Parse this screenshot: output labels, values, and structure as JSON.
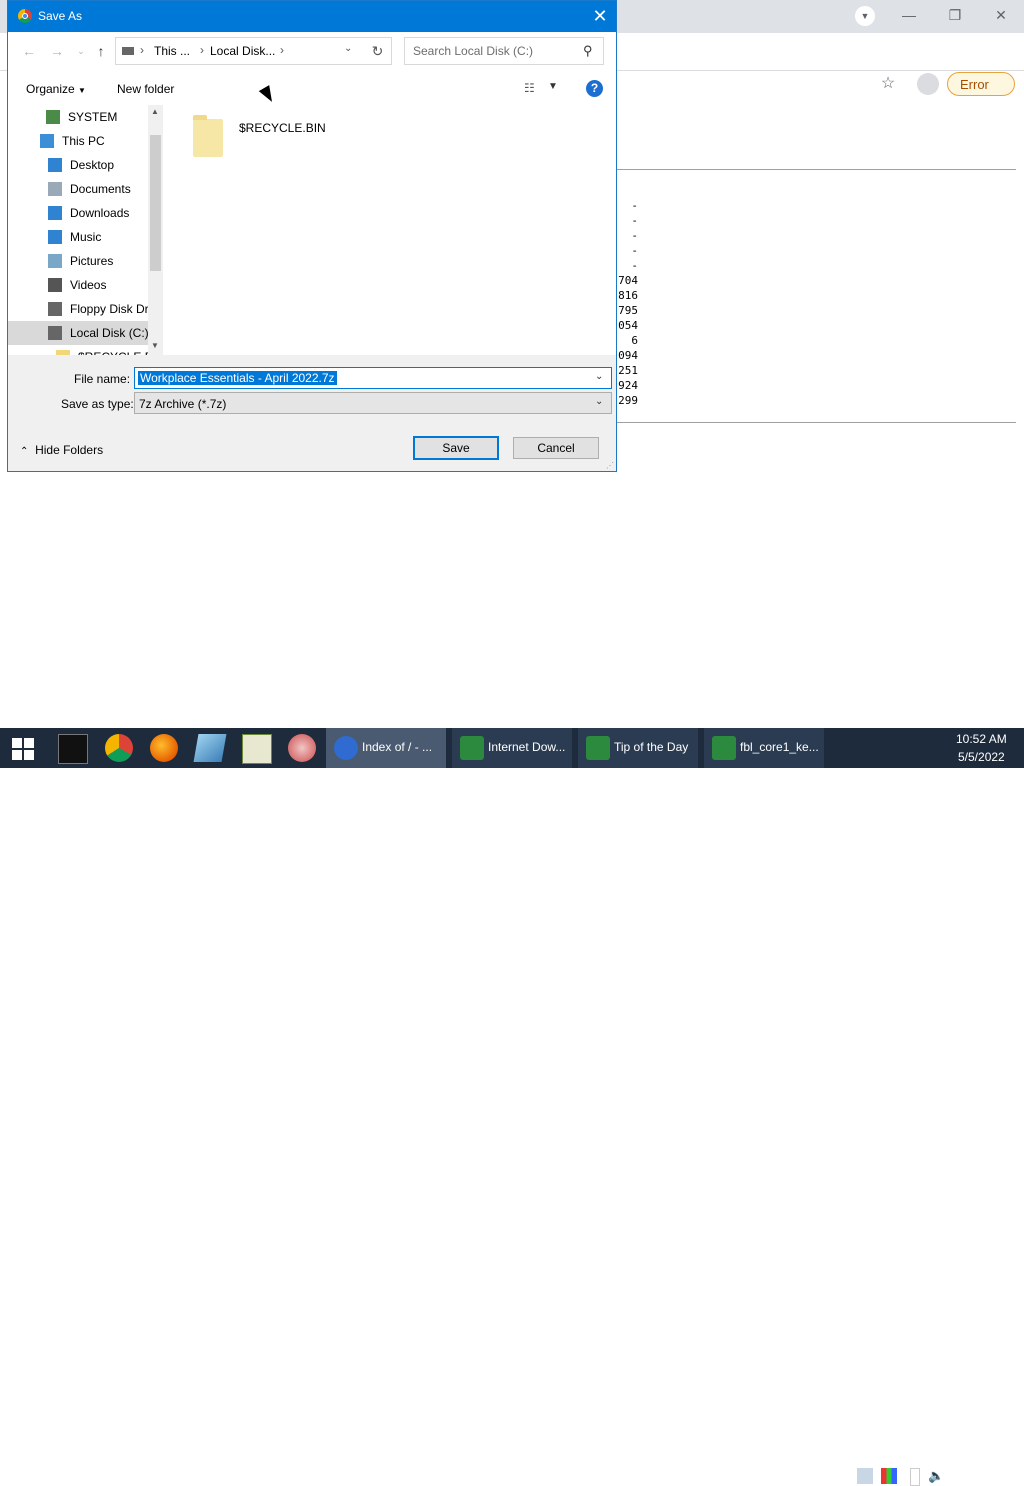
{
  "dialog": {
    "title": "Save As",
    "breadcrumb": [
      "This ...",
      "Local Disk..."
    ],
    "search_placeholder": "Search Local Disk (C:)",
    "organize_label": "Organize",
    "new_folder_label": "New folder",
    "tree": [
      {
        "label": "SYSTEM",
        "icon": "user-icon"
      },
      {
        "label": "This PC",
        "icon": "pc-icon"
      },
      {
        "label": "Desktop",
        "icon": "desktop-icon"
      },
      {
        "label": "Documents",
        "icon": "documents-icon"
      },
      {
        "label": "Downloads",
        "icon": "downloads-icon"
      },
      {
        "label": "Music",
        "icon": "music-icon"
      },
      {
        "label": "Pictures",
        "icon": "pictures-icon"
      },
      {
        "label": "Videos",
        "icon": "videos-icon"
      },
      {
        "label": "Floppy Disk Dri",
        "icon": "floppy-icon"
      },
      {
        "label": "Local Disk (C:)",
        "icon": "disk-icon",
        "selected": true
      },
      {
        "label": "$RECYCLE.BIN",
        "icon": "folder-icon"
      }
    ],
    "files": [
      {
        "name": "$RECYCLE.BIN",
        "icon": "folder-icon"
      }
    ],
    "file_name_label": "File name:",
    "file_name_value": "Workplace Essentials - April 2022.7z",
    "save_type_label": "Save as type:",
    "save_type_value": "7z Archive (*.7z)",
    "hide_folders_label": "Hide Folders",
    "save_label": "Save",
    "cancel_label": "Cancel"
  },
  "browser": {
    "error_label": "Error",
    "index_sizes": [
      "-",
      "-",
      "-",
      "-",
      "-",
      "704",
      "816",
      "795",
      "054",
      "6",
      "094",
      "251",
      "924",
      "299"
    ]
  },
  "taskbar": {
    "buttons": [
      {
        "label": "Index of / - ...",
        "active": true
      },
      {
        "label": "Internet Dow..."
      },
      {
        "label": "Tip of the Day"
      },
      {
        "label": "fbl_core1_ke..."
      }
    ],
    "time": "10:52 AM",
    "date": "5/5/2022"
  }
}
